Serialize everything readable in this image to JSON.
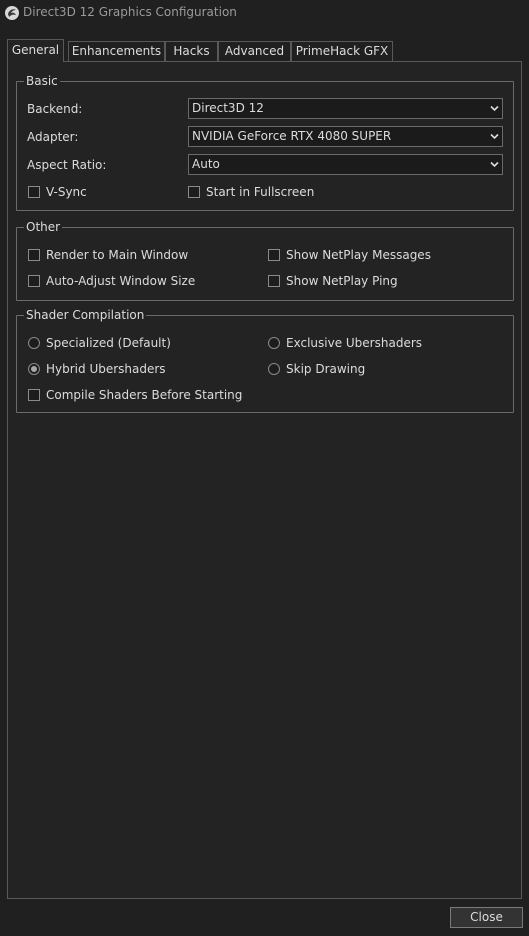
{
  "window": {
    "title": "Direct3D 12 Graphics Configuration"
  },
  "tabs": [
    "General",
    "Enhancements",
    "Hacks",
    "Advanced",
    "PrimeHack GFX"
  ],
  "basic": {
    "legend": "Basic",
    "backend_label": "Backend:",
    "backend_value": "Direct3D 12",
    "adapter_label": "Adapter:",
    "adapter_value": "NVIDIA GeForce RTX 4080 SUPER",
    "aspect_label": "Aspect Ratio:",
    "aspect_value": "Auto",
    "vsync_label": "V-Sync",
    "vsync_checked": false,
    "fullscreen_label": "Start in Fullscreen",
    "fullscreen_checked": false
  },
  "other": {
    "legend": "Other",
    "render_main_label": "Render to Main Window",
    "netplay_messages_label": "Show NetPlay Messages",
    "auto_adjust_label": "Auto-Adjust Window Size",
    "netplay_ping_label": "Show NetPlay Ping"
  },
  "shader": {
    "legend": "Shader Compilation",
    "specialized_label": "Specialized (Default)",
    "exclusive_label": "Exclusive Ubershaders",
    "hybrid_label": "Hybrid Ubershaders",
    "skip_label": "Skip Drawing",
    "selected": "Hybrid Ubershaders",
    "compile_before_label": "Compile Shaders Before Starting"
  },
  "footer": {
    "close_label": "Close"
  },
  "colors": {
    "background": "#202020",
    "border": "#595959",
    "text": "#dcdcdc"
  }
}
